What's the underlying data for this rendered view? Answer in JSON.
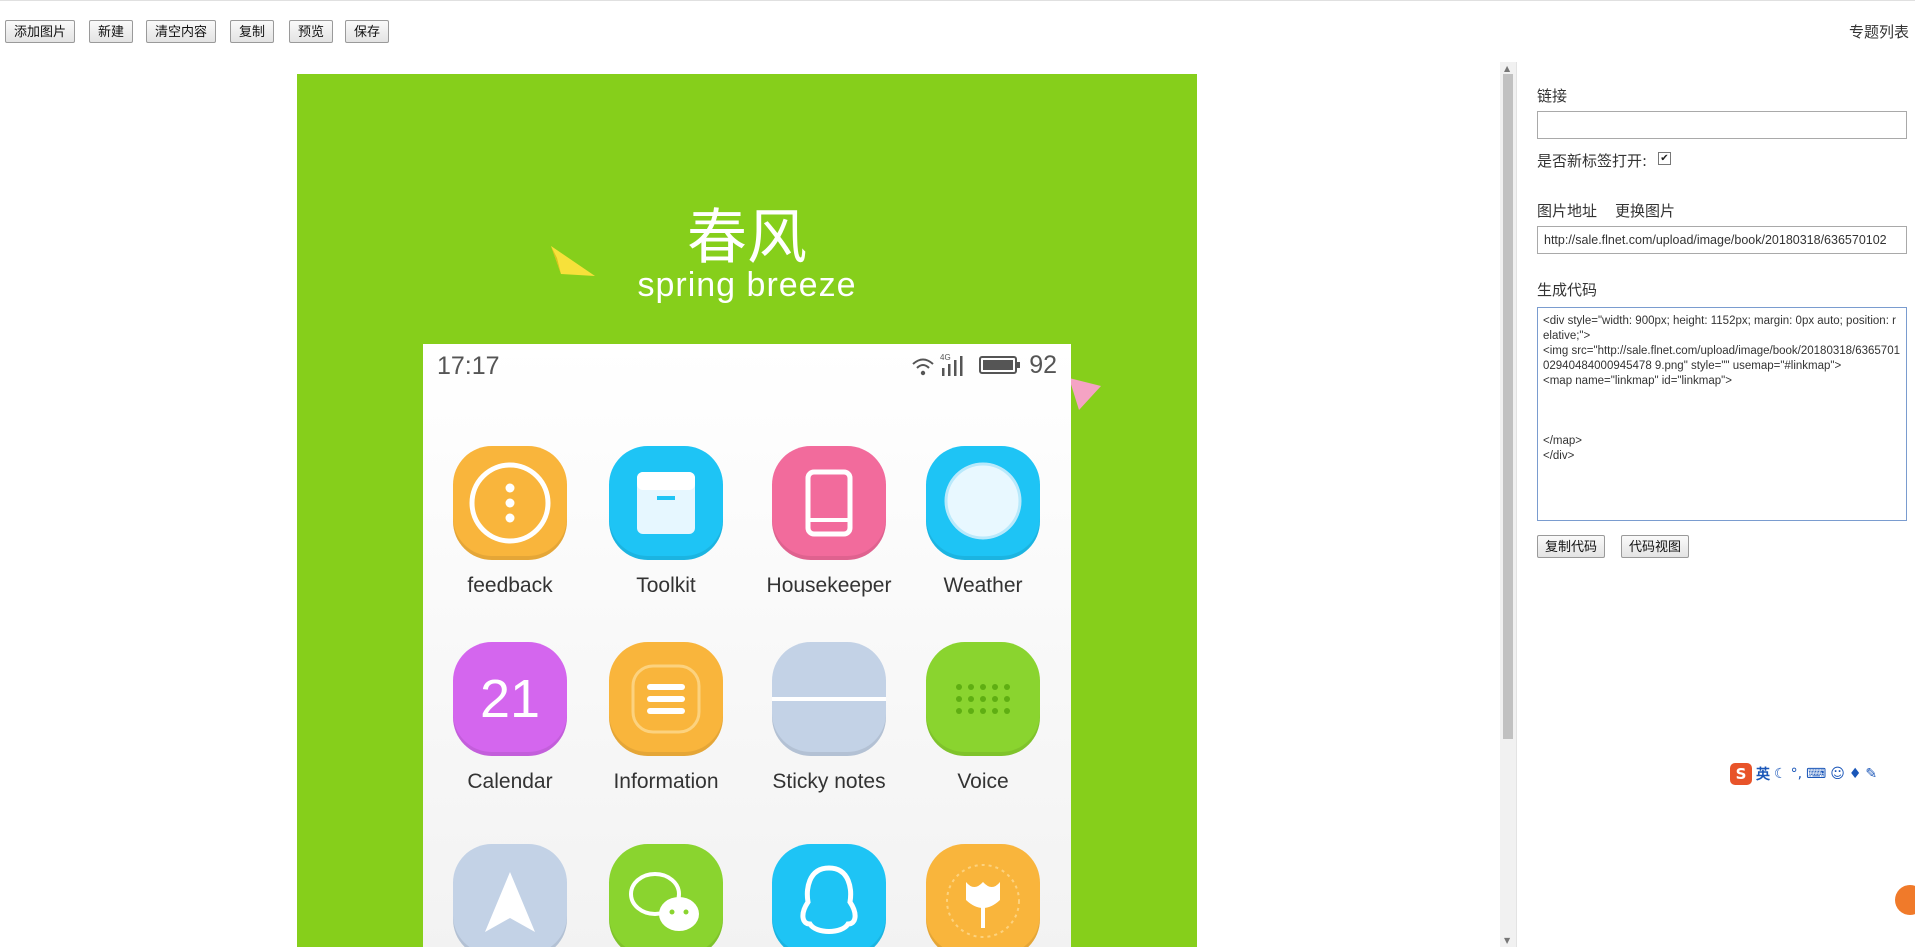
{
  "toolbar": {
    "buttons": [
      "添加图片",
      "新建",
      "清空内容",
      "复制",
      "预览",
      "保存"
    ],
    "topic_list": "专题列表"
  },
  "poster": {
    "title_cn": "春风",
    "title_en": "spring breeze",
    "background": "#86cf1b",
    "status_time": "17:17",
    "status_network": "4G",
    "status_battery": "92",
    "apps": [
      {
        "label": "feedback",
        "icon": "feedback-icon",
        "color": "#f9b53c"
      },
      {
        "label": "Toolkit",
        "icon": "toolkit-icon",
        "color": "#1ec4f5"
      },
      {
        "label": "Housekeeper",
        "icon": "housekeeper-icon",
        "color": "#f26b9c"
      },
      {
        "label": "Weather",
        "icon": "weather-icon",
        "color": "#1ec4f5"
      },
      {
        "label": "Calendar",
        "icon": "calendar-icon",
        "color": "#d466ee",
        "glyph": "21"
      },
      {
        "label": "Information",
        "icon": "information-icon",
        "color": "#f9b53c"
      },
      {
        "label": "Sticky notes",
        "icon": "sticky-notes-icon",
        "color": "#c3d2e6"
      },
      {
        "label": "Voice",
        "icon": "voice-icon",
        "color": "#8ad42f"
      },
      {
        "label": "",
        "icon": "navigation-icon",
        "color": "#c3d2e6"
      },
      {
        "label": "",
        "icon": "wechat-icon",
        "color": "#8ad42f"
      },
      {
        "label": "",
        "icon": "qq-icon",
        "color": "#1ec4f5"
      },
      {
        "label": "",
        "icon": "flower-icon",
        "color": "#f9b53c"
      }
    ]
  },
  "panel": {
    "link_label": "链接",
    "link_value": "",
    "new_tab_label": "是否新标签打开:",
    "new_tab_checked": true,
    "image_url_label": "图片地址",
    "change_image_label": "更换图片",
    "image_url_value": "http://sale.flnet.com/upload/image/book/20180318/636570102",
    "code_label": "生成代码",
    "code_value": "<div style=\"width: 900px; height: 1152px; margin: 0px auto; position: relative;\">\n<img src=\"http://sale.flnet.com/upload/image/book/20180318/636570102940484000945478 9.png\" style=\"\" usemap=\"#linkmap\">\n<map name=\"linkmap\" id=\"linkmap\">\n\n\n\n</map>\n</div>",
    "copy_code_label": "复制代码",
    "code_view_label": "代码视图"
  },
  "ime": {
    "mode": "英"
  }
}
